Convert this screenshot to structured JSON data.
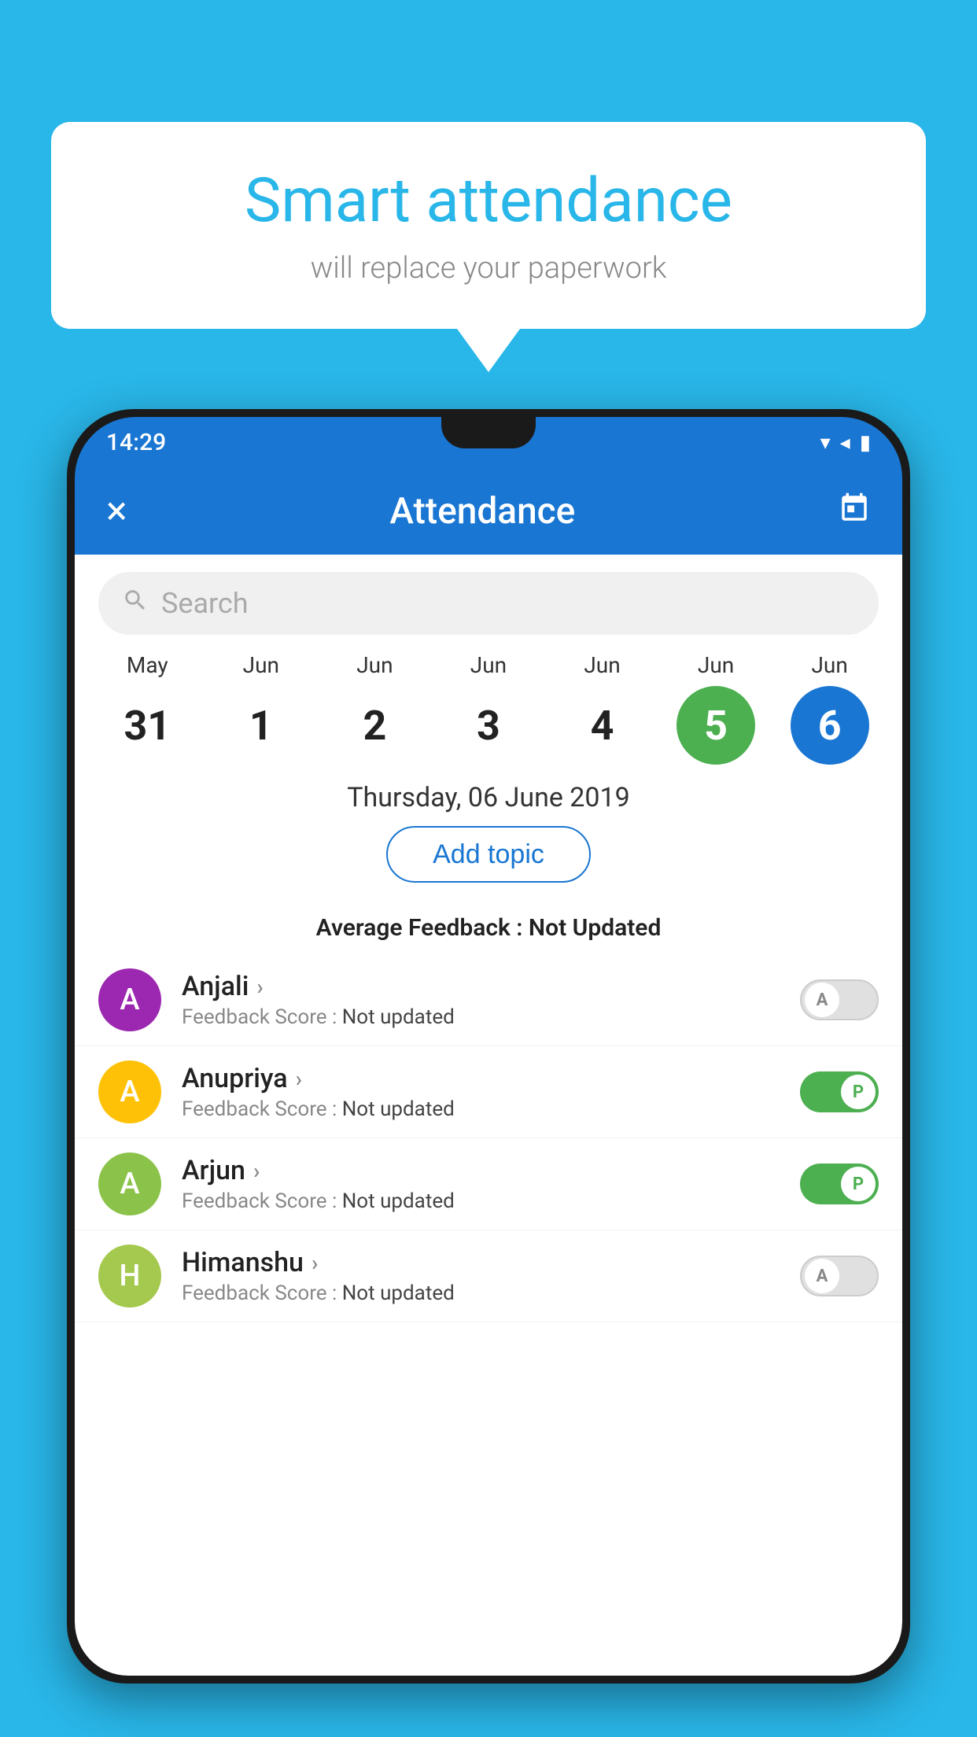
{
  "background_color": "#29b6e8",
  "speech_bubble": {
    "title": "Smart attendance",
    "subtitle": "will replace your paperwork"
  },
  "status_bar": {
    "time": "14:29",
    "signal_icon": "▼◄▐",
    "wifi": "▼",
    "signal": "◄",
    "battery": "▐"
  },
  "app_bar": {
    "close_label": "×",
    "title": "Attendance",
    "calendar_label": "📅"
  },
  "search": {
    "placeholder": "Search"
  },
  "calendar": {
    "days": [
      {
        "month": "May",
        "date": "31",
        "state": "normal"
      },
      {
        "month": "Jun",
        "date": "1",
        "state": "normal"
      },
      {
        "month": "Jun",
        "date": "2",
        "state": "normal"
      },
      {
        "month": "Jun",
        "date": "3",
        "state": "normal"
      },
      {
        "month": "Jun",
        "date": "4",
        "state": "normal"
      },
      {
        "month": "Jun",
        "date": "5",
        "state": "today"
      },
      {
        "month": "Jun",
        "date": "6",
        "state": "selected"
      }
    ]
  },
  "selected_date": "Thursday, 06 June 2019",
  "add_topic_label": "Add topic",
  "avg_feedback_label": "Average Feedback :",
  "avg_feedback_value": "Not Updated",
  "students": [
    {
      "name": "Anjali",
      "feedback_label": "Feedback Score :",
      "feedback_value": "Not updated",
      "avatar_letter": "A",
      "avatar_color": "#9c27b0",
      "attendance": "absent",
      "toggle_letter": "A"
    },
    {
      "name": "Anupriya",
      "feedback_label": "Feedback Score :",
      "feedback_value": "Not updated",
      "avatar_letter": "A",
      "avatar_color": "#ffc107",
      "attendance": "present",
      "toggle_letter": "P"
    },
    {
      "name": "Arjun",
      "feedback_label": "Feedback Score :",
      "feedback_value": "Not updated",
      "avatar_letter": "A",
      "avatar_color": "#8bc34a",
      "attendance": "present",
      "toggle_letter": "P"
    },
    {
      "name": "Himanshu",
      "feedback_label": "Feedback Score :",
      "feedback_value": "Not updated",
      "avatar_letter": "H",
      "avatar_color": "#a5c94e",
      "attendance": "absent",
      "toggle_letter": "A"
    }
  ]
}
